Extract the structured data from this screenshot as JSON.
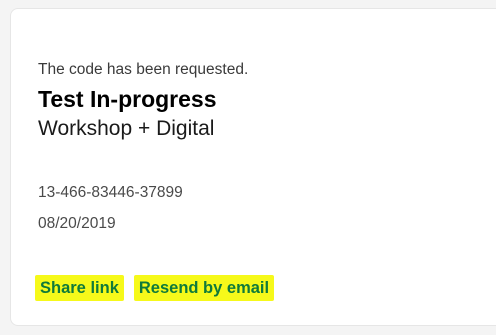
{
  "card": {
    "status_text": "The code has been requested.",
    "title": "Test In-progress",
    "subtitle": "Workshop + Digital",
    "code": "13-466-83446-37899",
    "date": "08/20/2019",
    "actions": {
      "share_label": "Share link",
      "resend_label": "Resend by email"
    }
  },
  "colors": {
    "link_text": "#0f7a3a",
    "highlight": "#f6f91a",
    "card_background": "#ffffff",
    "page_background": "#f4f4f4"
  }
}
